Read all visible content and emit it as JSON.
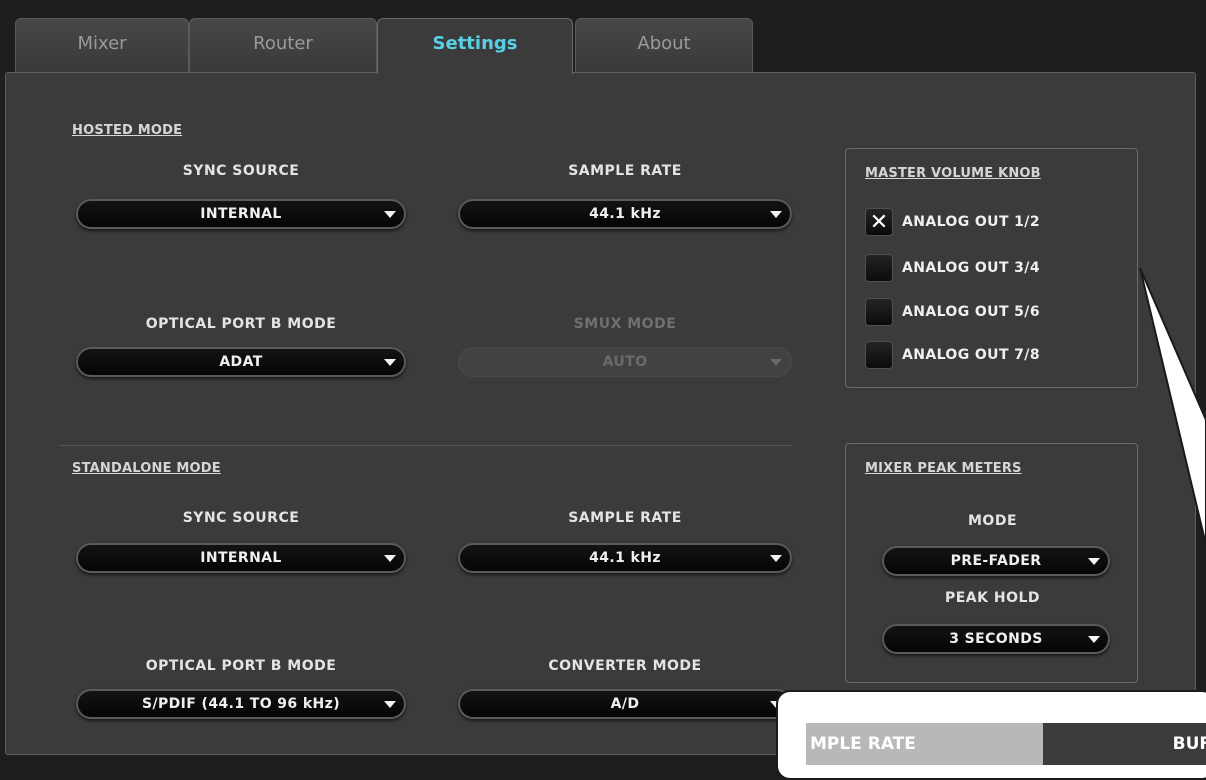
{
  "tabs": [
    {
      "label": "Mixer",
      "active": false
    },
    {
      "label": "Router",
      "active": false
    },
    {
      "label": "Settings",
      "active": true
    },
    {
      "label": "About",
      "active": false
    }
  ],
  "hosted": {
    "section_label": "HOSTED MODE",
    "sync_source": {
      "label": "SYNC SOURCE",
      "value": "INTERNAL"
    },
    "sample_rate": {
      "label": "SAMPLE RATE",
      "value": "44.1 kHz"
    },
    "optical_b": {
      "label": "OPTICAL PORT B MODE",
      "value": "ADAT"
    },
    "smux": {
      "label": "SMUX MODE",
      "value": "AUTO",
      "disabled": true
    }
  },
  "standalone": {
    "section_label": "STANDALONE MODE",
    "sync_source": {
      "label": "SYNC SOURCE",
      "value": "INTERNAL"
    },
    "sample_rate": {
      "label": "SAMPLE RATE",
      "value": "44.1 kHz"
    },
    "optical_b": {
      "label": "OPTICAL PORT B MODE",
      "value": "S/PDIF (44.1 TO 96 kHz)"
    },
    "converter": {
      "label": "CONVERTER MODE",
      "value": "A/D"
    }
  },
  "master_volume": {
    "title": "MASTER VOLUME KNOB",
    "options": [
      {
        "label": "ANALOG OUT 1/2",
        "checked": true,
        "mark": "✕"
      },
      {
        "label": "ANALOG OUT 3/4",
        "checked": false
      },
      {
        "label": "ANALOG OUT 5/6",
        "checked": false
      },
      {
        "label": "ANALOG OUT 7/8",
        "checked": false
      }
    ]
  },
  "peak_meters": {
    "title": "MIXER PEAK METERS",
    "mode_label": "MODE",
    "mode_value": "PRE-FADER",
    "hold_label": "PEAK HOLD",
    "hold_value": "3 SECONDS"
  },
  "callout": {
    "sample_rate_text": "MPLE RATE",
    "buffer_text": "BUF"
  },
  "colors": {
    "active_tab": "#5ad0e6",
    "panel_bg": "#3b3b3b",
    "dropdown_bg": "#0a0a0a"
  }
}
